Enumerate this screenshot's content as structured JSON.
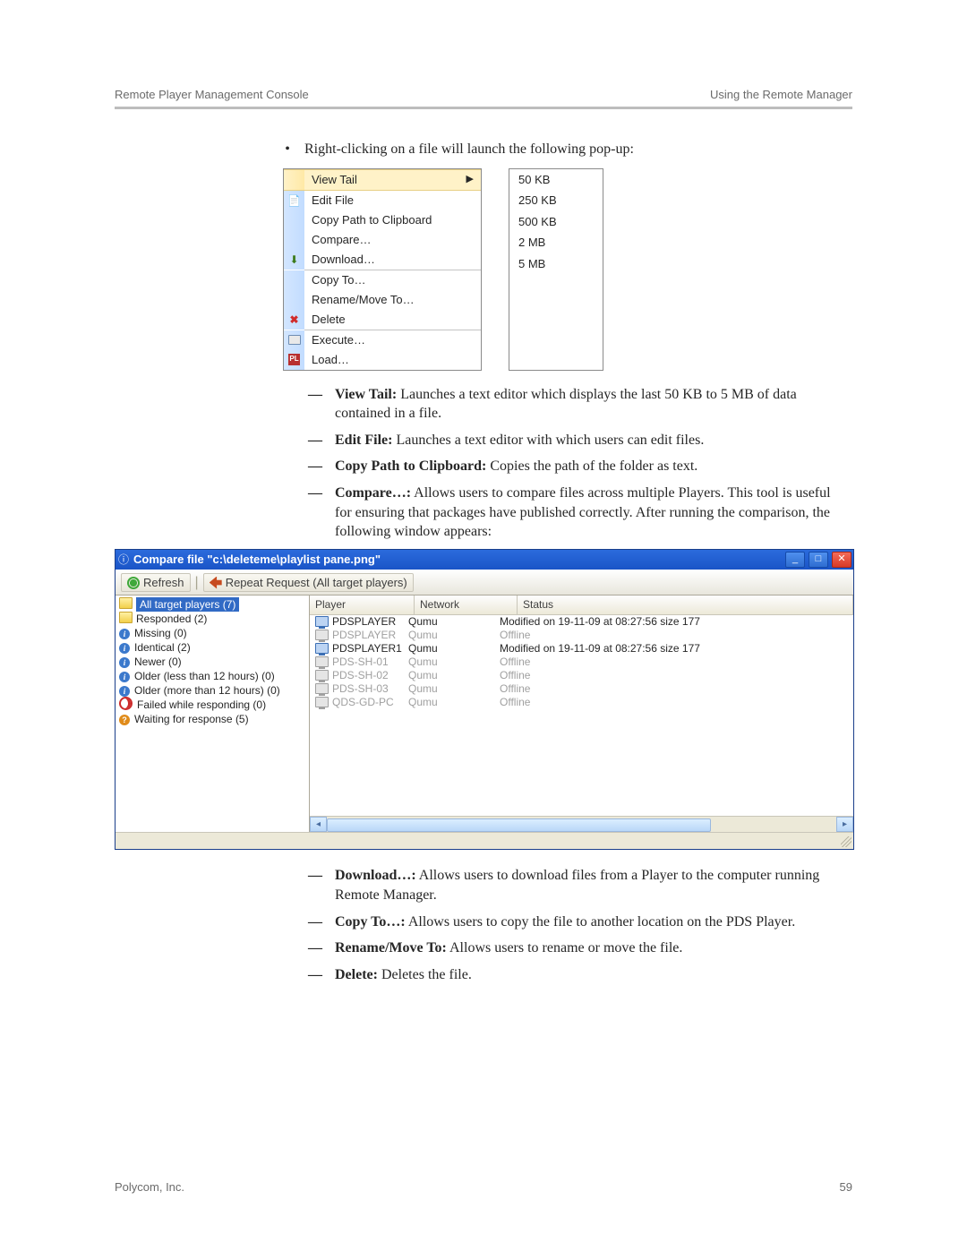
{
  "header": {
    "left": "Remote Player Management Console",
    "right": "Using the Remote Manager"
  },
  "footer": {
    "left": "Polycom, Inc.",
    "right": "59"
  },
  "intro_bullet": "Right-clicking on a file will launch the following pop-up:",
  "ctx_menu": {
    "items": [
      {
        "label": "View Tail",
        "has_submenu": true,
        "hl": true,
        "icon_name": ""
      },
      {
        "label": "Edit File",
        "icon_name": "edit"
      },
      {
        "label": "Copy Path to Clipboard"
      },
      {
        "label": "Compare…"
      },
      {
        "label": "Download…",
        "icon_name": "dl"
      },
      {
        "sep": true
      },
      {
        "label": "Copy To…"
      },
      {
        "label": "Rename/Move To…"
      },
      {
        "label": "Delete",
        "icon_name": "del"
      },
      {
        "sep": true
      },
      {
        "label": "Execute…",
        "icon_name": "exec"
      },
      {
        "label": "Load…",
        "icon_name": "load"
      }
    ],
    "submenu": [
      "50 KB",
      "250 KB",
      "500 KB",
      "2 MB",
      "5 MB"
    ]
  },
  "defs1": [
    {
      "term": "View Tail:",
      "text": " Launches a text editor which displays the last 50 KB to 5 MB of data contained in a file."
    },
    {
      "term": "Edit File:",
      "text": " Launches a text editor with which users can edit files."
    },
    {
      "term": "Copy Path to Clipboard:",
      "text": " Copies the path of the folder as text."
    },
    {
      "term": "Compare…:",
      "text": " Allows users to compare files across multiple Players. This tool is useful for ensuring that packages have published correctly. After running the comparison, the following window appears:"
    }
  ],
  "win": {
    "title": "Compare file \"c:\\deleteme\\playlist pane.png\"",
    "toolbar": {
      "refresh": "Refresh",
      "repeat": "Repeat Request (All target players)"
    },
    "tree": [
      {
        "lvl": 0,
        "cls": "folder",
        "label": "All target players (7)",
        "sel": true
      },
      {
        "lvl": 1,
        "cls": "folder",
        "label": "Responded (2)"
      },
      {
        "lvl": 2,
        "cls": "info",
        "label": "Missing (0)"
      },
      {
        "lvl": 2,
        "cls": "info",
        "label": "Identical (2)"
      },
      {
        "lvl": 2,
        "cls": "info",
        "label": "Newer (0)"
      },
      {
        "lvl": 2,
        "cls": "info",
        "label": "Older (less than 12 hours) (0)"
      },
      {
        "lvl": 2,
        "cls": "info",
        "label": "Older (more than 12 hours) (0)"
      },
      {
        "lvl": 1,
        "cls": "fail",
        "label": "Failed while responding (0)"
      },
      {
        "lvl": 1,
        "cls": "wait",
        "label": "Waiting for response (5)"
      }
    ],
    "columns": {
      "player": "Player",
      "network": "Network",
      "status": "Status"
    },
    "rows": [
      {
        "player": "PDSPLAYER",
        "net": "Qumu",
        "status": "Modified on 19-11-09 at 08:27:56 size 177",
        "dim": false
      },
      {
        "player": "PDSPLAYER",
        "net": "Qumu",
        "status": "Offline",
        "dim": true
      },
      {
        "player": "PDSPLAYER1",
        "net": "Qumu",
        "status": "Modified on 19-11-09 at 08:27:56 size 177",
        "dim": false
      },
      {
        "player": "PDS-SH-01",
        "net": "Qumu",
        "status": "Offline",
        "dim": true
      },
      {
        "player": "PDS-SH-02",
        "net": "Qumu",
        "status": "Offline",
        "dim": true
      },
      {
        "player": "PDS-SH-03",
        "net": "Qumu",
        "status": "Offline",
        "dim": true
      },
      {
        "player": "QDS-GD-PC",
        "net": "Qumu",
        "status": "Offline",
        "dim": true
      }
    ]
  },
  "defs2": [
    {
      "term": "Download…:",
      "text": " Allows users to download files from a Player to the computer running Remote Manager."
    },
    {
      "term": "Copy To…:",
      "text": " Allows users to copy the file to another location on the PDS Player."
    },
    {
      "term": "Rename/Move To:",
      "text": " Allows users to rename or move the file."
    },
    {
      "term": "Delete:",
      "text": " Deletes the file."
    }
  ]
}
